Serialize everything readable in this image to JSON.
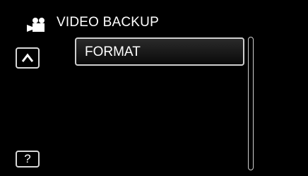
{
  "header": {
    "icon": "video-camera-icon",
    "title": "VIDEO BACKUP"
  },
  "navigation": {
    "up_icon": "chevron-up-icon"
  },
  "menu": {
    "items": [
      {
        "label": "FORMAT"
      }
    ]
  },
  "scrollbar": {
    "position": 0.0
  },
  "help": {
    "label": "?"
  },
  "colors": {
    "background": "#000000",
    "text": "#ffffff",
    "border": "#cfcfcf"
  }
}
